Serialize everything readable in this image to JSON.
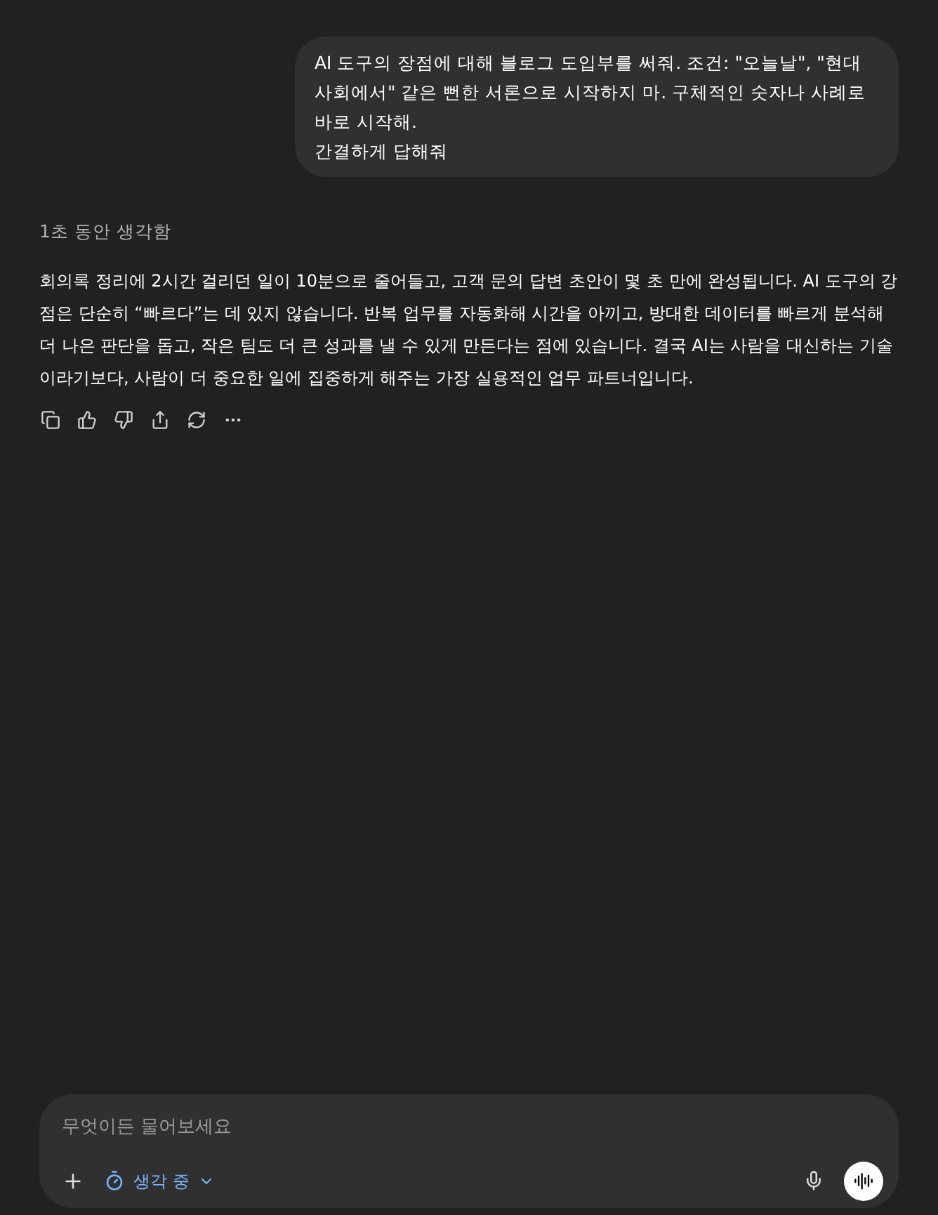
{
  "user_message": {
    "lines": [
      "AI 도구의 장점에 대해 블로그 도입부를 써줘. 조건: \"오늘날\", \"현대 사회에서\" 같은 뻔한 서론으로 시작하지 마. 구체적인 숫자나 사례로 바로 시작해.",
      "간결하게 답해줘"
    ]
  },
  "assistant": {
    "thinking_label": "1초 동안 생각함",
    "response": "회의록 정리에 2시간 걸리던 일이 10분으로 줄어들고, 고객 문의 답변 초안이 몇 초 만에 완성됩니다. AI 도구의 강점은 단순히 “빠르다”는 데 있지 않습니다. 반복 업무를 자동화해 시간을 아끼고, 방대한 데이터를 빠르게 분석해 더 나은 판단을 돕고, 작은 팀도 더 큰 성과를 낼 수 있게 만든다는 점에 있습니다. 결국 AI는 사람을 대신하는 기술이라기보다, 사람이 더 중요한 일에 집중하게 해주는 가장 실용적인 업무 파트너입니다.",
    "actions": [
      {
        "kind": "copy"
      },
      {
        "kind": "like"
      },
      {
        "kind": "dislike"
      },
      {
        "kind": "share"
      },
      {
        "kind": "regenerate"
      },
      {
        "kind": "more"
      }
    ]
  },
  "composer": {
    "placeholder": "무엇이든 물어보세요",
    "mode_label": "생각 중"
  }
}
